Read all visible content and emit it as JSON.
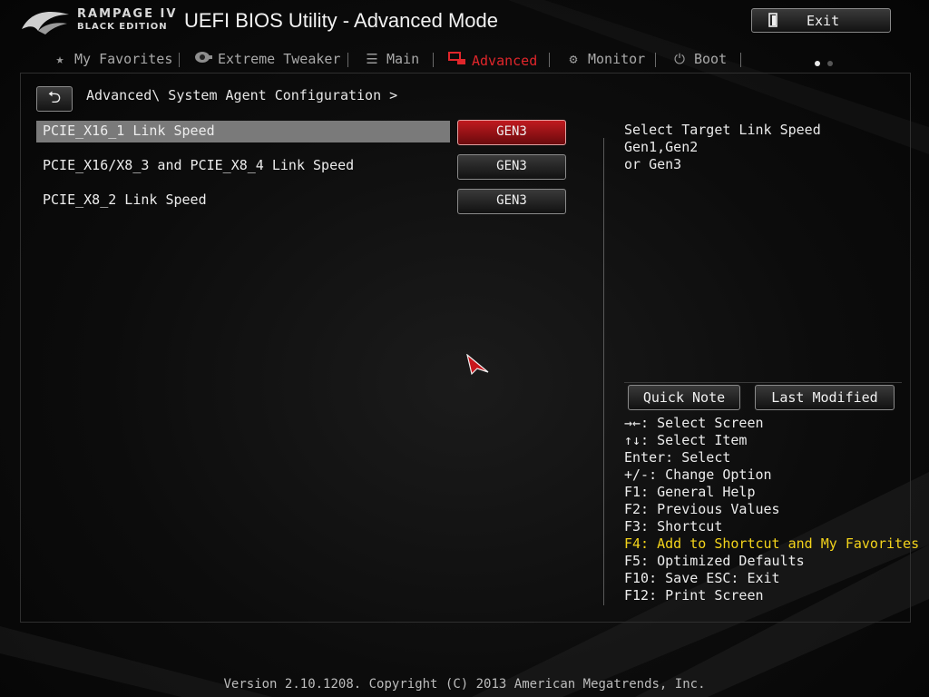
{
  "header": {
    "brand_line1": "RAMPAGE IV",
    "brand_line2": "BLACK EDITION",
    "title": "UEFI BIOS Utility - Advanced Mode",
    "exit_label": "Exit"
  },
  "tabs": [
    {
      "label": "My Favorites",
      "icon": "star-icon",
      "active": false
    },
    {
      "label": "Extreme Tweaker",
      "icon": "tweaker-icon",
      "active": false
    },
    {
      "label": "Main",
      "icon": "list-icon",
      "active": false
    },
    {
      "label": "Advanced",
      "icon": "advanced-icon",
      "active": true
    },
    {
      "label": "Monitor",
      "icon": "monitor-icon",
      "active": false
    },
    {
      "label": "Boot",
      "icon": "power-icon",
      "active": false
    }
  ],
  "breadcrumb": "Advanced\\ System Agent Configuration >",
  "settings": [
    {
      "label": "PCIE_X16_1 Link Speed",
      "value": "GEN3",
      "selected": true
    },
    {
      "label": "PCIE_X16/X8_3 and PCIE_X8_4 Link Speed",
      "value": "GEN3",
      "selected": false
    },
    {
      "label": "PCIE_X8_2 Link Speed",
      "value": "GEN3",
      "selected": false
    }
  ],
  "help": {
    "line1": "Select Target Link Speed Gen1,Gen2",
    "line2": "or Gen3"
  },
  "buttons": {
    "quick_note": "Quick Note",
    "last_modified": "Last Modified"
  },
  "keys": [
    "→←: Select Screen",
    "↑↓: Select Item",
    "Enter: Select",
    "+/-: Change Option",
    "F1: General Help",
    "F2: Previous Values",
    "F3: Shortcut",
    "F4: Add to Shortcut and My Favorites",
    "F5: Optimized Defaults",
    "F10: Save  ESC: Exit",
    "F12: Print Screen"
  ],
  "footer": "Version 2.10.1208. Copyright (C) 2013 American Megatrends, Inc.",
  "colors": {
    "accent": "#e0262b",
    "highlight": "#f3d31b",
    "selected_row": "#7a7a7a"
  }
}
